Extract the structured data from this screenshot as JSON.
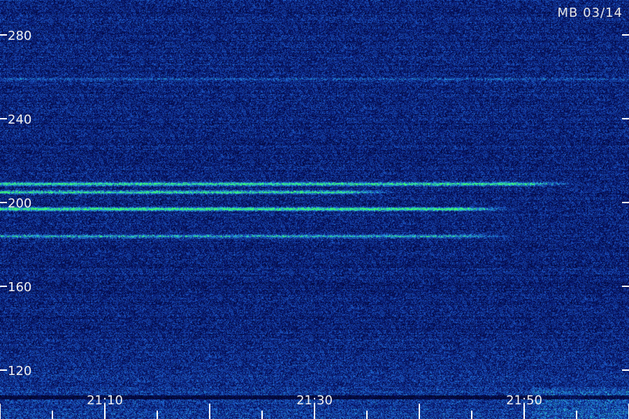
{
  "chart_data": {
    "type": "heatmap",
    "title": "MB 03/14",
    "xlabel": "",
    "ylabel": "",
    "x_tick_labels": [
      "21:10",
      "21:30",
      "21:50"
    ],
    "x_range": [
      "21:02",
      "22:02"
    ],
    "y_tick_labels": [
      "120",
      "160",
      "200",
      "240",
      "280"
    ],
    "y_ticks": [
      120,
      160,
      200,
      240,
      280
    ],
    "ylim": [
      96,
      296
    ],
    "grid": false,
    "legend": "none",
    "bands": [
      {
        "y": 209,
        "time_end": "21:50",
        "intensity": 0.85
      },
      {
        "y": 205,
        "time_end": "21:33",
        "intensity": 0.8
      },
      {
        "y": 197,
        "time_end": "21:44",
        "intensity": 0.95
      },
      {
        "y": 184,
        "time_end": "21:44",
        "intensity": 0.55
      },
      {
        "y": 259,
        "time_end": "22:02",
        "intensity": 0.3
      }
    ],
    "colors": {
      "background": "#0b1c7a",
      "noise_low": "#061063",
      "noise_mid": "#1e5fd0",
      "noise_high": "#27b6e0",
      "band": "#3dff6a",
      "axis": "#ffffff"
    }
  }
}
